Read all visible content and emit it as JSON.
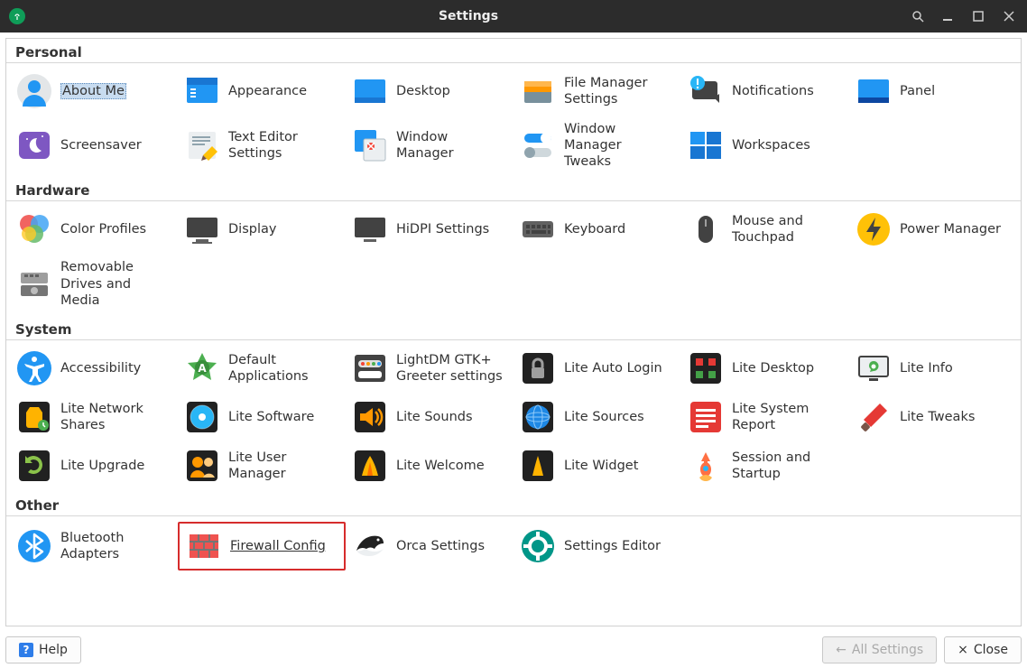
{
  "window": {
    "title": "Settings",
    "controls": {
      "search": "search",
      "minimize": "_",
      "maximize": "▢",
      "close": "×"
    }
  },
  "sections": {
    "personal": {
      "title": "Personal",
      "items": [
        {
          "id": "about-me",
          "label": "About Me"
        },
        {
          "id": "appearance",
          "label": "Appearance"
        },
        {
          "id": "desktop",
          "label": "Desktop"
        },
        {
          "id": "file-manager",
          "label": "File Manager Settings"
        },
        {
          "id": "notifications",
          "label": "Notifications"
        },
        {
          "id": "panel",
          "label": "Panel"
        },
        {
          "id": "screensaver",
          "label": "Screensaver"
        },
        {
          "id": "text-editor",
          "label": "Text Editor Settings"
        },
        {
          "id": "window-manager",
          "label": "Window Manager"
        },
        {
          "id": "wm-tweaks",
          "label": "Window Manager Tweaks"
        },
        {
          "id": "workspaces",
          "label": "Workspaces"
        }
      ]
    },
    "hardware": {
      "title": "Hardware",
      "items": [
        {
          "id": "color-profiles",
          "label": "Color Profiles"
        },
        {
          "id": "display",
          "label": "Display"
        },
        {
          "id": "hidpi",
          "label": "HiDPI Settings"
        },
        {
          "id": "keyboard",
          "label": "Keyboard"
        },
        {
          "id": "mouse",
          "label": "Mouse and Touchpad"
        },
        {
          "id": "power",
          "label": "Power Manager"
        },
        {
          "id": "removable",
          "label": "Removable Drives and Media"
        }
      ]
    },
    "system": {
      "title": "System",
      "items": [
        {
          "id": "accessibility",
          "label": "Accessibility"
        },
        {
          "id": "default-apps",
          "label": "Default Applications"
        },
        {
          "id": "lightdm",
          "label": "LightDM GTK+ Greeter settings"
        },
        {
          "id": "auto-login",
          "label": "Lite Auto Login"
        },
        {
          "id": "lite-desktop",
          "label": "Lite Desktop"
        },
        {
          "id": "lite-info",
          "label": "Lite Info"
        },
        {
          "id": "lite-network",
          "label": "Lite Network Shares"
        },
        {
          "id": "lite-software",
          "label": "Lite Software"
        },
        {
          "id": "lite-sounds",
          "label": "Lite Sounds"
        },
        {
          "id": "lite-sources",
          "label": "Lite Sources"
        },
        {
          "id": "lite-sysreport",
          "label": "Lite System Report"
        },
        {
          "id": "lite-tweaks",
          "label": "Lite Tweaks"
        },
        {
          "id": "lite-upgrade",
          "label": "Lite Upgrade"
        },
        {
          "id": "lite-user",
          "label": "Lite User Manager"
        },
        {
          "id": "lite-welcome",
          "label": "Lite Welcome"
        },
        {
          "id": "lite-widget",
          "label": "Lite Widget"
        },
        {
          "id": "session-startup",
          "label": "Session and Startup"
        }
      ]
    },
    "other": {
      "title": "Other",
      "items": [
        {
          "id": "bluetooth",
          "label": "Bluetooth Adapters"
        },
        {
          "id": "firewall",
          "label": "Firewall Config"
        },
        {
          "id": "orca",
          "label": "Orca Settings"
        },
        {
          "id": "settings-editor",
          "label": "Settings Editor"
        }
      ]
    }
  },
  "selected_item": "about-me",
  "highlighted_item": "firewall",
  "buttons": {
    "help": "Help",
    "all_settings": "All Settings",
    "close": "Close"
  }
}
